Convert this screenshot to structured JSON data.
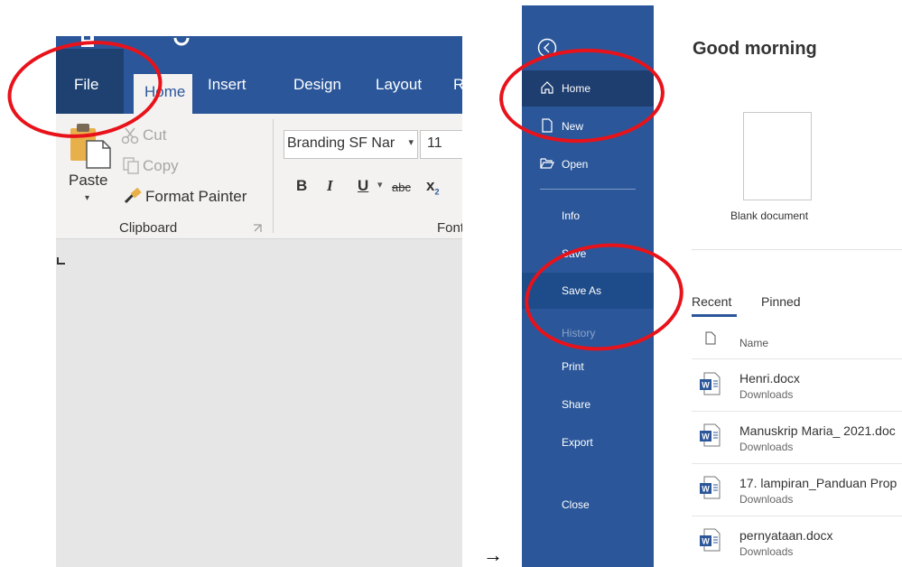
{
  "left_panel": {
    "tabs": {
      "file": "File",
      "home": "Home",
      "insert": "Insert",
      "design": "Design",
      "layout": "Layout",
      "references_partial": "R"
    },
    "clipboard": {
      "cut": "Cut",
      "copy": "Copy",
      "paste": "Paste",
      "format_painter": "Format Painter",
      "group_label": "Clipboard"
    },
    "font": {
      "name": "Branding SF Nar",
      "size": "11",
      "group_label_partial": "Font",
      "bold": "B",
      "italic": "I",
      "underline": "U",
      "strike": "abc",
      "subscript": "x"
    }
  },
  "arrow": "→",
  "backstage": {
    "greeting": "Good morning",
    "nav": {
      "home": "Home",
      "new": "New",
      "open": "Open",
      "info": "Info",
      "save": "Save",
      "save_as": "Save As",
      "history": "History",
      "print": "Print",
      "share": "Share",
      "export": "Export",
      "close": "Close"
    },
    "blank_document": "Blank document",
    "tabs": {
      "recent": "Recent",
      "pinned": "Pinned"
    },
    "column_name": "Name",
    "files": [
      {
        "name": "Henri.docx",
        "location": "Downloads"
      },
      {
        "name": "Manuskrip Maria_ 2021.doc",
        "location": "Downloads"
      },
      {
        "name": "17. lampiran_Panduan Prop",
        "location": "Downloads"
      },
      {
        "name": "pernyataan.docx",
        "location": "Downloads"
      }
    ]
  },
  "colors": {
    "word_blue": "#2b579a",
    "file_tab_dark": "#1e4172",
    "annotation_red": "#e8121a"
  }
}
